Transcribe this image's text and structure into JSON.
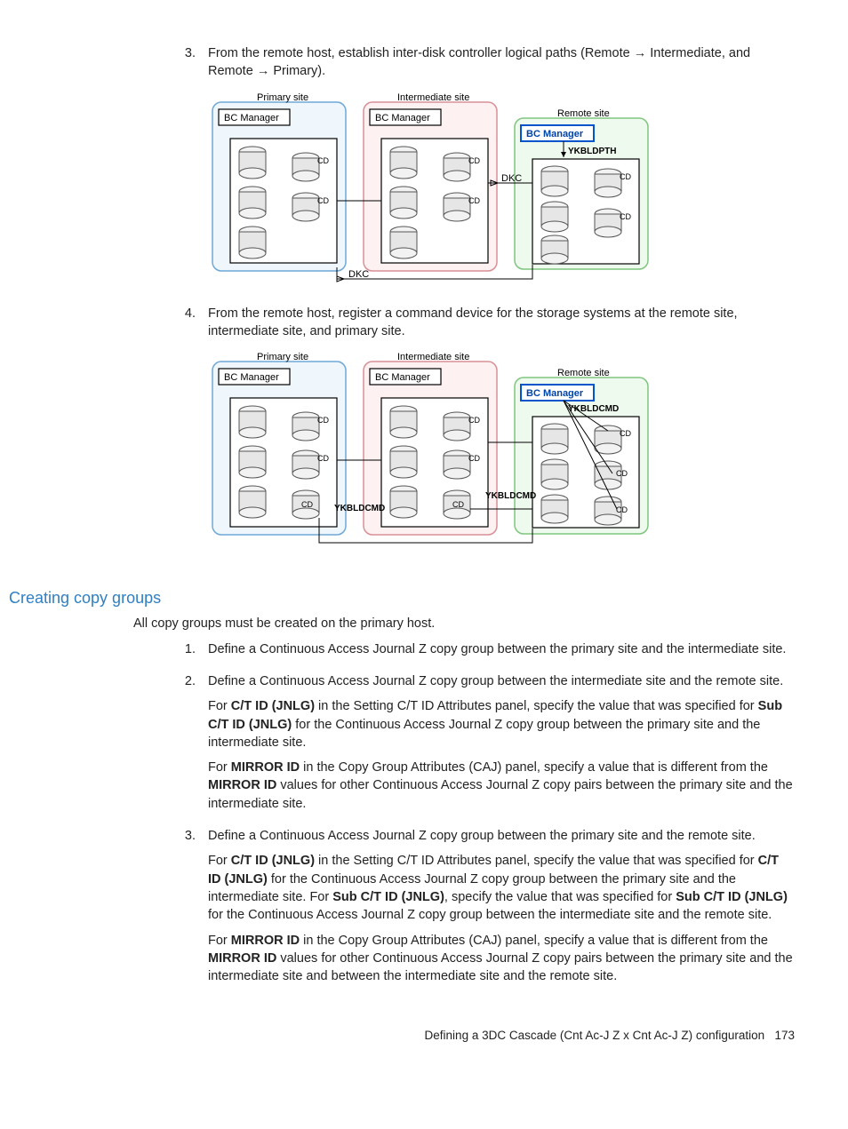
{
  "steps_top": [
    {
      "num": "3.",
      "text_parts": [
        "From the remote host, establish inter-disk controller logical paths (Remote ",
        "→",
        " Intermediate, and Remote ",
        "→",
        " Primary)."
      ]
    },
    {
      "num": "4.",
      "text_parts": [
        "From the remote host, register a command device for the storage systems at the remote site, intermediate site, and primary site."
      ]
    }
  ],
  "section_heading": "Creating copy groups",
  "section_intro": "All copy groups must be created on the primary host.",
  "steps_bottom": [
    {
      "num": "1.",
      "paras": [
        {
          "runs": [
            {
              "t": "Define a Continuous Access Journal Z copy group between the primary site and the intermediate site."
            }
          ]
        }
      ]
    },
    {
      "num": "2.",
      "paras": [
        {
          "runs": [
            {
              "t": "Define a Continuous Access Journal Z copy group between the intermediate site and the remote site."
            }
          ]
        },
        {
          "runs": [
            {
              "t": "For "
            },
            {
              "t": "C/T ID (JNLG)",
              "b": true
            },
            {
              "t": " in the Setting C/T ID Attributes panel, specify the value that was specified for "
            },
            {
              "t": "Sub C/T ID (JNLG)",
              "b": true
            },
            {
              "t": " for the Continuous Access Journal Z copy group between the primary site and the intermediate site."
            }
          ]
        },
        {
          "runs": [
            {
              "t": "For "
            },
            {
              "t": "MIRROR ID",
              "b": true
            },
            {
              "t": " in the Copy Group Attributes (CAJ) panel, specify a value that is different from the "
            },
            {
              "t": "MIRROR ID",
              "b": true
            },
            {
              "t": " values for other Continuous Access Journal Z copy pairs between the primary site and the intermediate site."
            }
          ]
        }
      ]
    },
    {
      "num": "3.",
      "paras": [
        {
          "runs": [
            {
              "t": "Define a Continuous Access Journal Z copy group between the primary site and the remote site."
            }
          ]
        },
        {
          "runs": [
            {
              "t": "For "
            },
            {
              "t": "C/T ID (JNLG)",
              "b": true
            },
            {
              "t": " in the Setting C/T ID Attributes panel, specify the value that was specified for "
            },
            {
              "t": "C/T ID (JNLG)",
              "b": true
            },
            {
              "t": " for the Continuous Access Journal Z copy group between the primary site and the intermediate site. For "
            },
            {
              "t": "Sub C/T ID (JNLG)",
              "b": true
            },
            {
              "t": ", specify the value that was specified for "
            },
            {
              "t": "Sub C/T ID (JNLG)",
              "b": true
            },
            {
              "t": " for the Continuous Access Journal Z copy group between the intermediate site and the remote site."
            }
          ]
        },
        {
          "runs": [
            {
              "t": "For "
            },
            {
              "t": "MIRROR ID",
              "b": true
            },
            {
              "t": " in the Copy Group Attributes (CAJ) panel, specify a value that is different from the "
            },
            {
              "t": "MIRROR ID",
              "b": true
            },
            {
              "t": " values for other Continuous Access Journal Z copy pairs between the primary site and the intermediate site and between the intermediate site and the remote site."
            }
          ]
        }
      ]
    }
  ],
  "diagram_labels": {
    "primary_site": "Primary site",
    "intermediate_site": "Intermediate site",
    "remote_site": "Remote site",
    "bc_manager": "BC Manager",
    "cd": "CD",
    "dkc": "DKC",
    "ykbldpth": "YKBLDPTH",
    "ykbldcmd": "YKBLDCMD"
  },
  "footer": {
    "text": "Defining a 3DC Cascade (Cnt Ac-J Z x Cnt Ac-J Z) configuration",
    "page": "173"
  }
}
